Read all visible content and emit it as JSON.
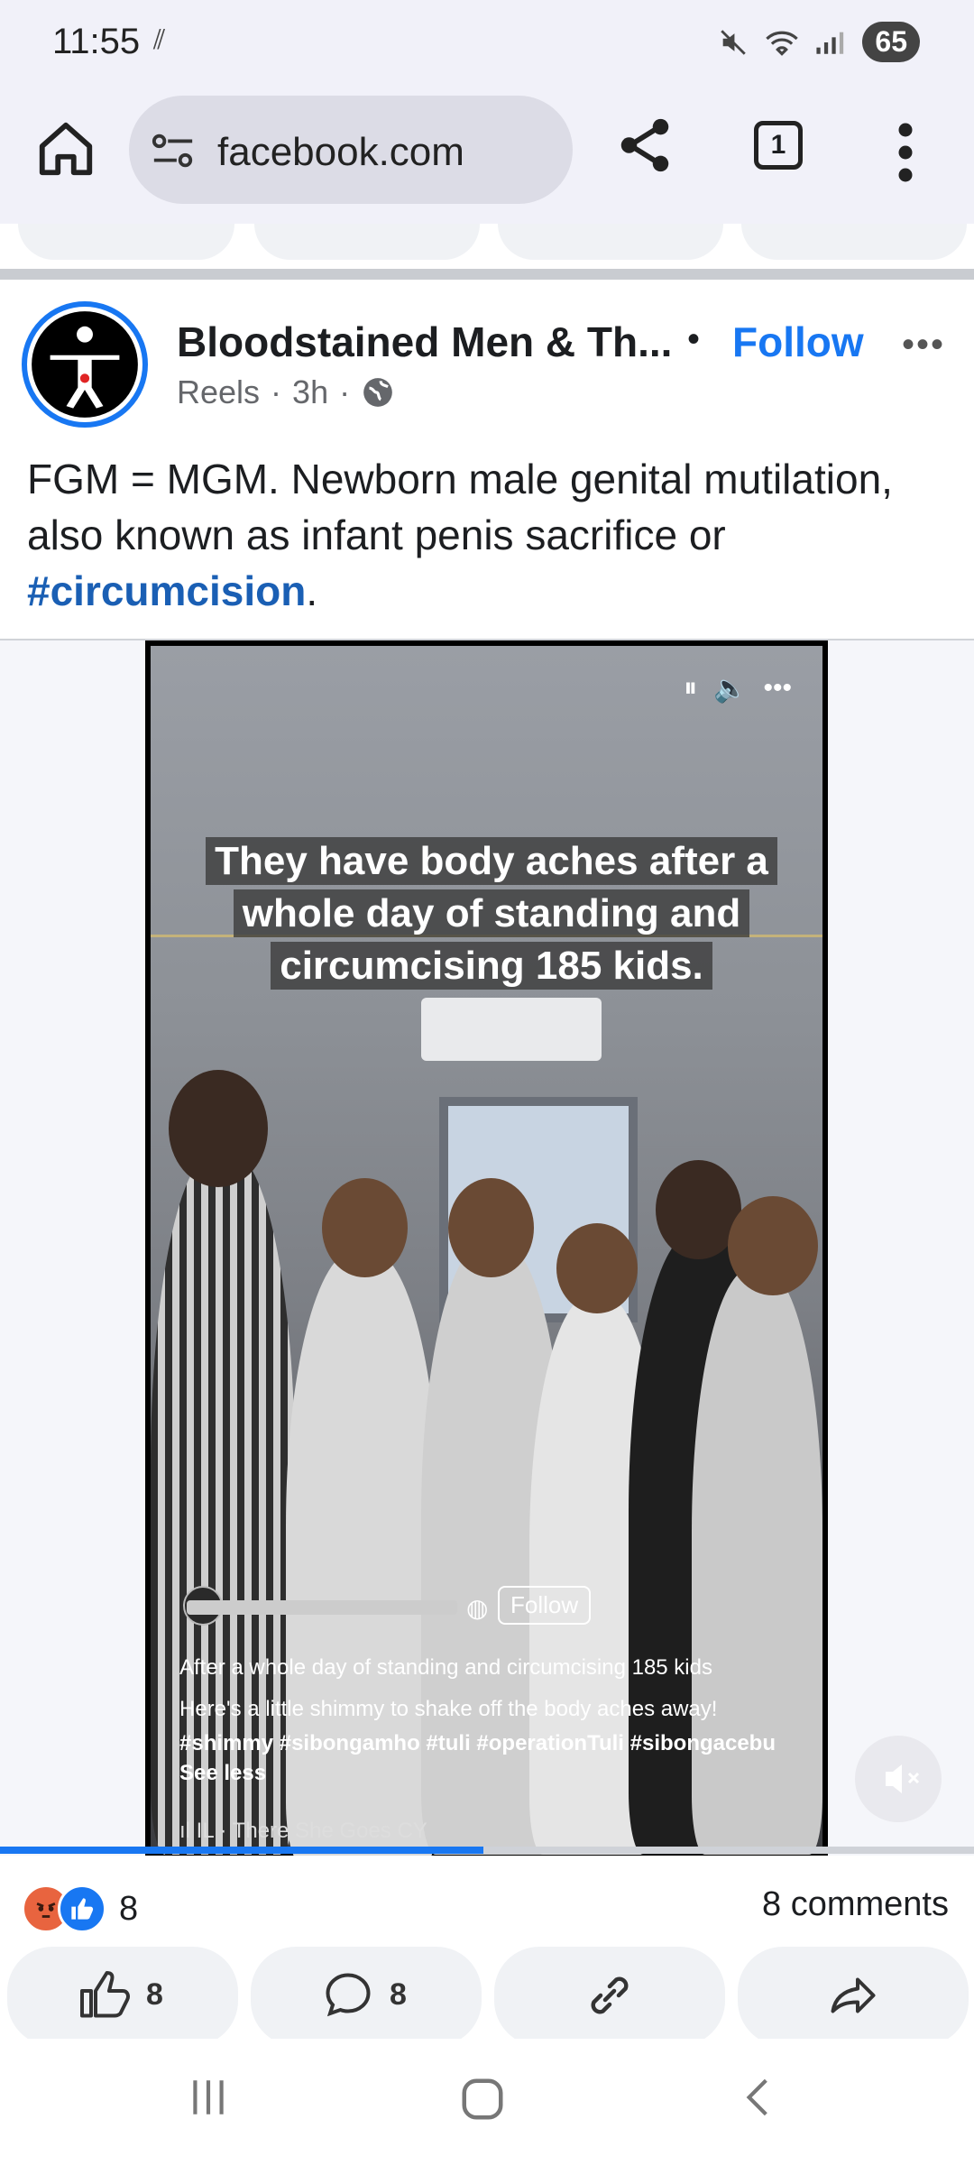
{
  "status_bar": {
    "time": "11:55",
    "battery": "65"
  },
  "browser": {
    "url": "facebook.com",
    "tab_count": "1"
  },
  "post": {
    "author": "Bloodstained Men & Th...",
    "separator": "•",
    "follow_label": "Follow",
    "meta": {
      "type": "Reels",
      "dot": "·",
      "time": "3h"
    },
    "text": "FGM = MGM. Newborn male genital mutilation, also known as infant penis sacrifice or ",
    "hashtag": "#circumcision",
    "text_end": "."
  },
  "video": {
    "caption": "They have body aches after a whole day of standing and circumcising 185 kids.",
    "follow_label": "Follow",
    "desc_line1": "After a whole day of standing and circumcising 185 kids",
    "desc_line2": "Here's a little shimmy to shake off the body aches away!",
    "tags": "#shimmy #sibongamho #tuli #operationTuli #sibongacebu",
    "see_less": "See less",
    "music": "IL · There She Goes     CY",
    "progress": 0.5
  },
  "engagement": {
    "reaction_count": "8",
    "comments": "8 comments",
    "like_count": "8",
    "comment_count": "8"
  },
  "colors": {
    "accent": "#1877f2",
    "hashtag": "#1a5fb4",
    "secondary_text": "#65676b"
  }
}
